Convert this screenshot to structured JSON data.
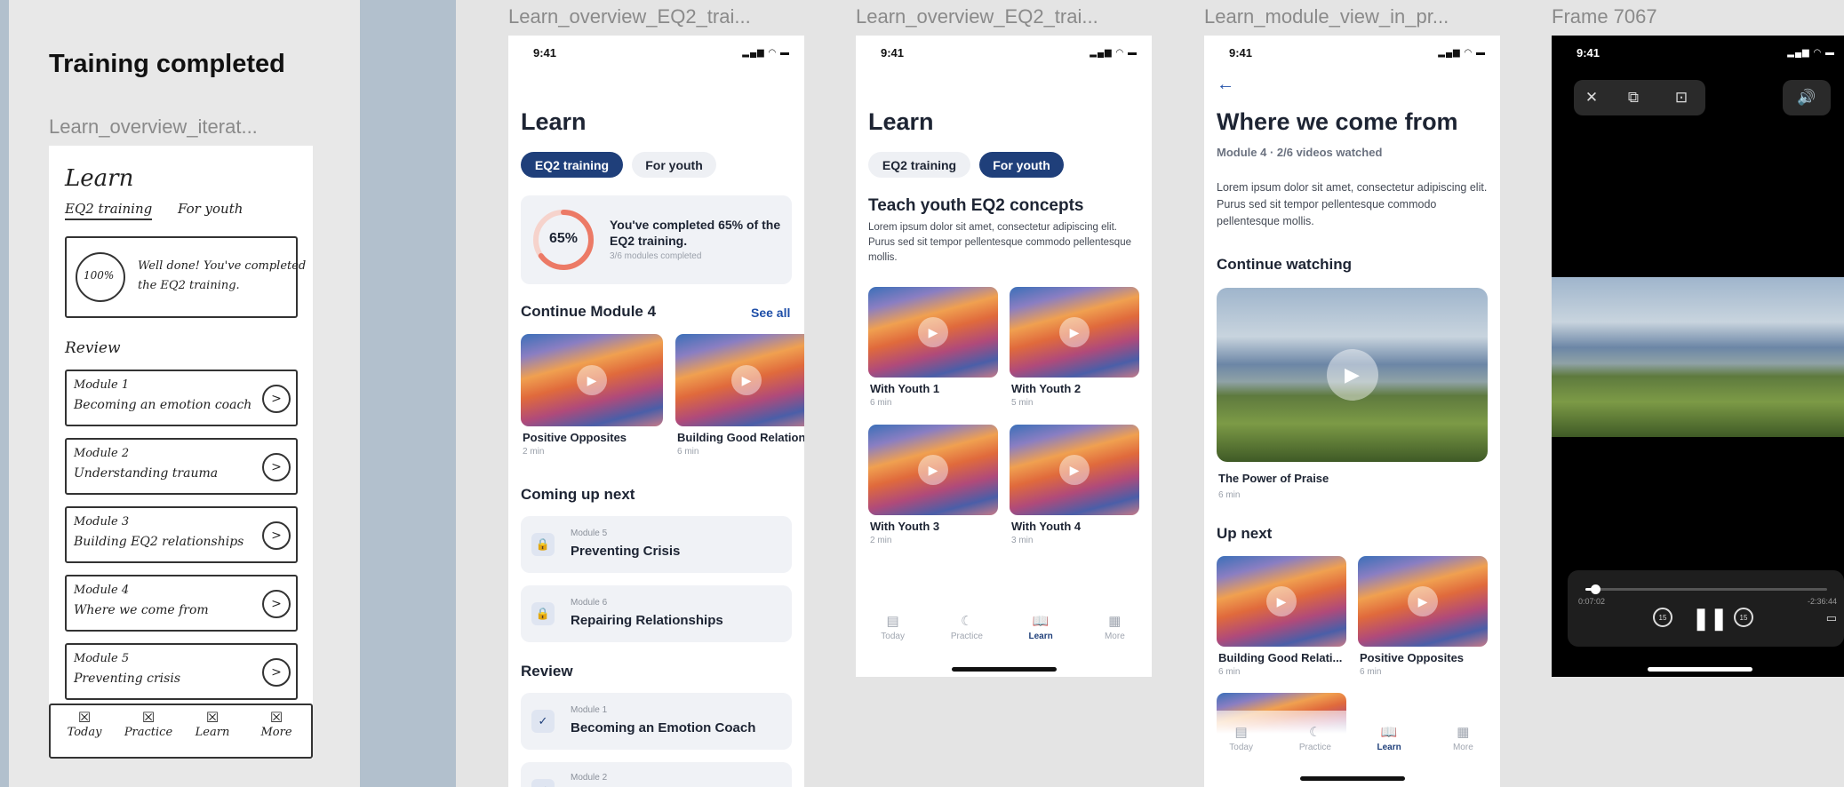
{
  "section_title": "Training completed",
  "wireframe": {
    "frame_label": "Learn_overview_iterat...",
    "title": "Learn",
    "tabs": [
      "EQ2 training",
      "For youth"
    ],
    "banner_badge": "100%",
    "banner_text_1": "Well done! You've completed",
    "banner_text_2": "the EQ2 training.",
    "review_label": "Review",
    "modules": [
      {
        "l1": "Module 1",
        "l2": "Becoming an emotion coach"
      },
      {
        "l1": "Module 2",
        "l2": "Understanding trauma"
      },
      {
        "l1": "Module 3",
        "l2": "Building EQ2 relationships"
      },
      {
        "l1": "Module 4",
        "l2": "Where we come from"
      },
      {
        "l1": "Module 5",
        "l2": "Preventing crisis"
      }
    ],
    "nav": [
      "Today",
      "Practice",
      "Learn",
      "More"
    ]
  },
  "status_time": "9:41",
  "status_icons": "▂▄▆ ◠ ▬",
  "icons": {
    "play": "play-icon",
    "lock": "lock-icon",
    "check": "check-icon",
    "back": "back-arrow-icon",
    "close": "close-icon"
  },
  "nav": [
    {
      "label": "Today",
      "icon": "▤"
    },
    {
      "label": "Practice",
      "icon": "☾"
    },
    {
      "label": "Learn",
      "icon": "📖"
    },
    {
      "label": "More",
      "icon": "▦"
    }
  ],
  "screen1": {
    "frame_label": "Learn_overview_EQ2_trai...",
    "title": "Learn",
    "tab_active": "EQ2 training",
    "tab_inactive": "For youth",
    "progress_value": 65,
    "progress_label": "65%",
    "progress_text": "You've completed 65% of the EQ2 training.",
    "progress_sub": "3/6 modules completed",
    "continue_title": "Continue Module 4",
    "see_all": "See all",
    "cards": [
      {
        "title": "Positive Opposites",
        "sub": "2 min"
      },
      {
        "title": "Building Good Relations",
        "sub": "6 min"
      }
    ],
    "coming_title": "Coming up next",
    "coming": [
      {
        "module": "Module 5",
        "title": "Preventing Crisis"
      },
      {
        "module": "Module 6",
        "title": "Repairing Relationships"
      }
    ],
    "review_title": "Review",
    "review": [
      {
        "module": "Module 1",
        "title": "Becoming an Emotion Coach"
      },
      {
        "module": "Module 2",
        "title": ""
      }
    ]
  },
  "screen2": {
    "frame_label": "Learn_overview_EQ2_trai...",
    "title": "Learn",
    "tab_inactive": "EQ2 training",
    "tab_active": "For youth",
    "heading": "Teach youth EQ2 concepts",
    "body": "Lorem ipsum dolor sit amet, consectetur adipiscing elit. Purus sed sit tempor pellentesque commodo pellentesque mollis.",
    "videos": [
      {
        "title": "With Youth 1",
        "sub": "6 min"
      },
      {
        "title": "With Youth 2",
        "sub": "5 min"
      },
      {
        "title": "With Youth 3",
        "sub": "2 min"
      },
      {
        "title": "With Youth 4",
        "sub": "3 min"
      }
    ]
  },
  "screen3": {
    "frame_label": "Learn_module_view_in_pr...",
    "title": "Where we come from",
    "subtitle": "Module 4 · 2/6 videos watched",
    "body": "Lorem ipsum dolor sit amet, consectetur adipiscing elit. Purus sed sit tempor pellentesque commodo pellentesque mollis.",
    "continue_title": "Continue watching",
    "hero_title": "The Power of Praise",
    "hero_sub": "6 min",
    "upnext_title": "Up next",
    "upnext": [
      {
        "title": "Building Good Relati...",
        "sub": "6 min"
      },
      {
        "title": "Positive Opposites",
        "sub": "6 min"
      }
    ]
  },
  "screen4": {
    "frame_label": "Frame 7067",
    "elapsed": "0:07:02",
    "remaining": "-2:36:44",
    "progress": 0.04,
    "skip_back": "15",
    "skip_fwd": "15"
  }
}
